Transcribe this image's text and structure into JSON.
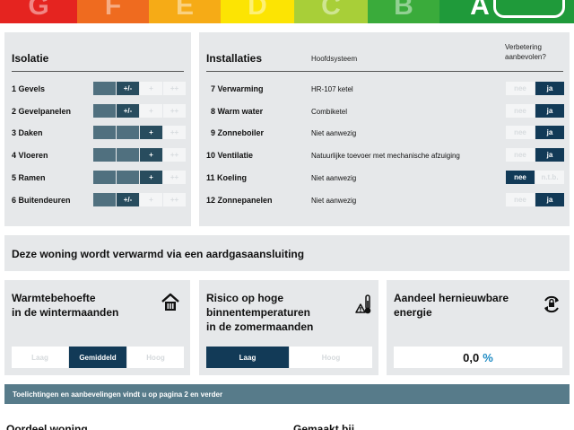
{
  "energy_label": {
    "classes": [
      {
        "letter": "G",
        "color": "#e52420"
      },
      {
        "letter": "F",
        "color": "#ef6b1f"
      },
      {
        "letter": "E",
        "color": "#f6ab16"
      },
      {
        "letter": "D",
        "color": "#fce403"
      },
      {
        "letter": "C",
        "color": "#a8cf38"
      },
      {
        "letter": "B",
        "color": "#3aab3b"
      },
      {
        "letter": "A",
        "color": "#1f9a3a"
      }
    ],
    "current": "A"
  },
  "isolatie": {
    "title": "Isolatie",
    "items": [
      {
        "label": "1  Gevels",
        "mark": "+/-",
        "filled": 1
      },
      {
        "label": "2  Gevelpanelen",
        "mark": "+/-",
        "filled": 1
      },
      {
        "label": "3  Daken",
        "mark": "+",
        "filled": 2
      },
      {
        "label": "4  Vloeren",
        "mark": "+",
        "filled": 2
      },
      {
        "label": "5  Ramen",
        "mark": "+",
        "filled": 2
      },
      {
        "label": "6  Buitendeuren",
        "mark": "+/-",
        "filled": 1
      }
    ],
    "scale_labels": [
      "-",
      "+/-",
      "+",
      "++"
    ]
  },
  "installaties": {
    "title": "Installaties",
    "col_hoofdsysteem": "Hoofdsysteem",
    "col_verbetering_1": "Verbetering",
    "col_verbetering_2": "aanbevolen?",
    "items": [
      {
        "label": "7  Verwarming",
        "value": "HR-107 ketel",
        "yes": "ja",
        "no": "nee",
        "selected": "ja"
      },
      {
        "label": "8  Warm water",
        "value": "Combiketel",
        "yes": "ja",
        "no": "nee",
        "selected": "ja"
      },
      {
        "label": "9  Zonneboiler",
        "value": "Niet aanwezig",
        "yes": "ja",
        "no": "nee",
        "selected": "ja"
      },
      {
        "label": "10  Ventilatie",
        "value": "Natuurlijke toevoer met mechanische afzuiging",
        "yes": "ja",
        "no": "nee",
        "selected": "ja"
      },
      {
        "label": "11  Koeling",
        "value": "Niet aanwezig",
        "yes": "n.t.b.",
        "no": "nee",
        "selected": "nee"
      },
      {
        "label": "12  Zonnepanelen",
        "value": "Niet aanwezig",
        "yes": "ja",
        "no": "nee",
        "selected": "ja"
      }
    ]
  },
  "heating_notice": "Deze woning wordt verwarmd via een aardgasaansluiting",
  "warmtebehoefte": {
    "title_1": "Warmtebehoefte",
    "title_2": "in de wintermaanden",
    "options": [
      "Laag",
      "Gemiddeld",
      "Hoog"
    ],
    "selected": "Gemiddeld",
    "icon": "house-heating-icon"
  },
  "risico": {
    "title_1": "Risico op hoge",
    "title_2": "binnentemperaturen",
    "title_3": "in de zomermaanden",
    "options": [
      "Laag",
      "Hoog"
    ],
    "selected": "Laag",
    "icon": "thermometer-warning-icon"
  },
  "hernieuwbaar": {
    "title_1": "Aandeel hernieuwbare",
    "title_2": "energie",
    "value": "0,0",
    "unit": "%",
    "icon": "renewable-cycle-icon"
  },
  "note_bar": "Toelichtingen en aanbevelingen vindt u op pagina 2 en verder",
  "footer": {
    "left": "Oordeel woning",
    "right": "Gemaakt bij"
  }
}
